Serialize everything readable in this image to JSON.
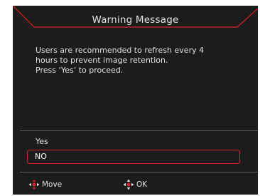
{
  "dialog": {
    "title": "Warning Message",
    "message_line1": "Users are recommended to refresh every 4",
    "message_line2": "hours to prevent image retention.",
    "message_line3": "Press ‘Yes’ to proceed.",
    "options": [
      {
        "label": "Yes",
        "selected": false
      },
      {
        "label": "NO",
        "selected": true
      }
    ]
  },
  "footer": {
    "move_label": "Move",
    "move_icon": "dpad-move-icon",
    "ok_label": "OK",
    "ok_icon": "dpad-ok-icon"
  },
  "colors": {
    "panel_bg": "#1c1c1c",
    "accent_red": "#d2232a",
    "divider": "#5e5e5e",
    "text": "#e2e2e2"
  }
}
